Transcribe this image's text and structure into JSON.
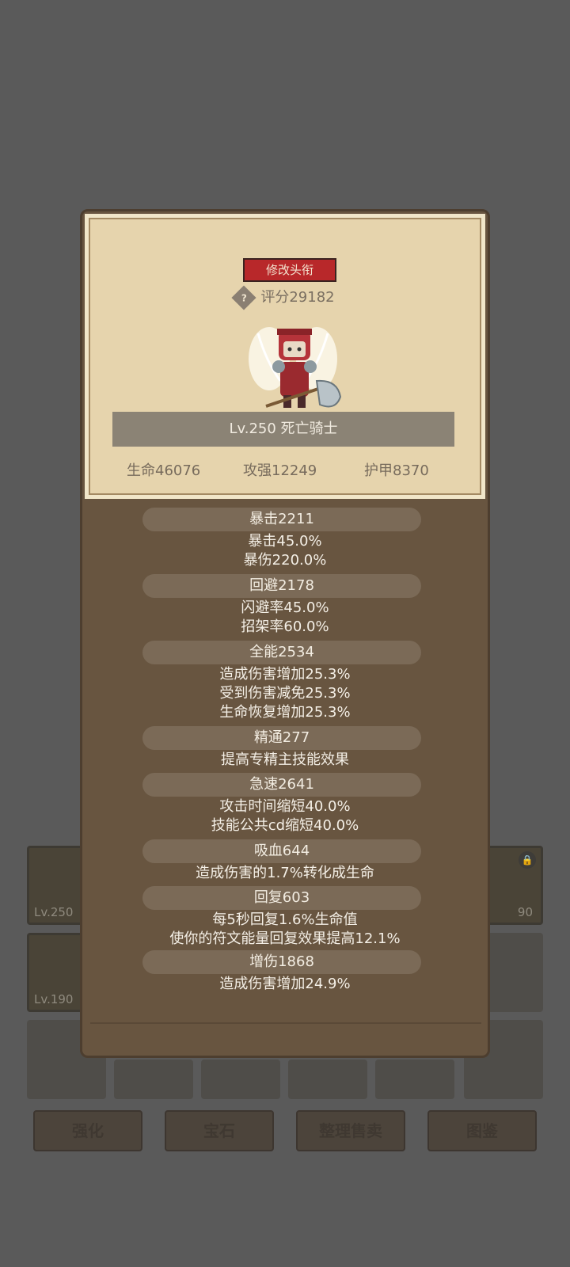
{
  "inventory": {
    "slot_levels": [
      "Lv.250",
      "90",
      "Lv.190"
    ]
  },
  "bottom_buttons": [
    "强化",
    "宝石",
    "整理售卖",
    "图鉴"
  ],
  "header": {
    "title_button": "修改头衔",
    "help_icon": "?",
    "score": "评分29182",
    "name": "Lv.250 死亡骑士",
    "hp": "生命46076",
    "atk": "攻强12249",
    "armor": "护甲8370"
  },
  "sections": [
    {
      "title": "暴击2211",
      "lines": [
        "暴击45.0%",
        "暴伤220.0%"
      ]
    },
    {
      "title": "回避2178",
      "lines": [
        "闪避率45.0%",
        "招架率60.0%"
      ]
    },
    {
      "title": "全能2534",
      "lines": [
        "造成伤害增加25.3%",
        "受到伤害减免25.3%",
        "生命恢复增加25.3%"
      ]
    },
    {
      "title": "精通277",
      "lines": [
        "提高专精主技能效果"
      ]
    },
    {
      "title": "急速2641",
      "lines": [
        "攻击时间缩短40.0%",
        "技能公共cd缩短40.0%"
      ]
    },
    {
      "title": "吸血644",
      "lines": [
        "造成伤害的1.7%转化成生命"
      ]
    },
    {
      "title": "回复603",
      "lines": [
        "每5秒回复1.6%生命值",
        "使你的符文能量回复效果提高12.1%"
      ]
    },
    {
      "title": "增伤1868",
      "lines": [
        "造成伤害增加24.9%"
      ]
    }
  ]
}
